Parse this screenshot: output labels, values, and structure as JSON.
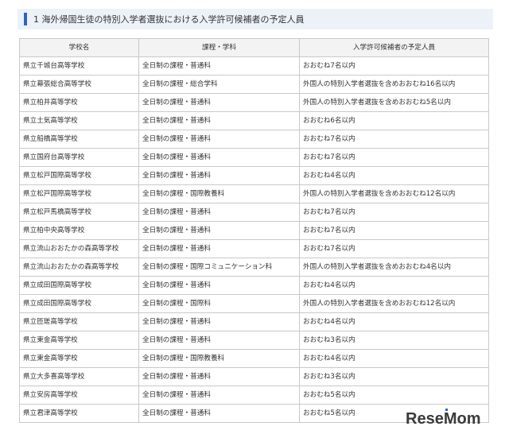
{
  "section": {
    "title": "1 海外帰国生徒の特別入学者選抜における入学許可候補者の予定人員"
  },
  "table": {
    "headers": [
      "学校名",
      "課程・学科",
      "入学許可候補者の予定人員"
    ],
    "rows": [
      [
        "県立千城台高等学校",
        "全日制の課程・普通科",
        "おおむね7名以内"
      ],
      [
        "県立幕張総合高等学校",
        "全日制の課程・総合学科",
        "外国人の特別入学者選抜を含めおおむね16名以内"
      ],
      [
        "県立柏井高等学校",
        "全日制の課程・普通科",
        "外国人の特別入学者選抜を含めおおむね5名以内"
      ],
      [
        "県立土気高等学校",
        "全日制の課程・普通科",
        "おおむね6名以内"
      ],
      [
        "県立船橋高等学校",
        "全日制の課程・普通科",
        "おおむね7名以内"
      ],
      [
        "県立国府台高等学校",
        "全日制の課程・普通科",
        "おおむね7名以内"
      ],
      [
        "県立松戸国際高等学校",
        "全日制の課程・普通科",
        "おおむね4名以内"
      ],
      [
        "県立松戸国際高等学校",
        "全日制の課程・国際教養科",
        "外国人の特別入学者選抜を含めおおむね12名以内"
      ],
      [
        "県立松戸馬橋高等学校",
        "全日制の課程・普通科",
        "おおむね7名以内"
      ],
      [
        "県立柏中央高等学校",
        "全日制の課程・普通科",
        "おおむね7名以内"
      ],
      [
        "県立流山おおたかの森高等学校",
        "全日制の課程・普通科",
        "おおむね7名以内"
      ],
      [
        "県立流山おおたかの森高等学校",
        "全日制の課程・国際コミュニケーション科",
        "外国人の特別入学者選抜を含めおおむね4名以内"
      ],
      [
        "県立成田国際高等学校",
        "全日制の課程・普通科",
        "おおむね4名以内"
      ],
      [
        "県立成田国際高等学校",
        "全日制の課程・国際科",
        "外国人の特別入学者選抜を含めおおむね12名以内"
      ],
      [
        "県立匝瑳高等学校",
        "全日制の課程・普通科",
        "おおむね4名以内"
      ],
      [
        "県立東金高等学校",
        "全日制の課程・普通科",
        "おおむね3名以内"
      ],
      [
        "県立東金高等学校",
        "全日制の課程・国際教養科",
        "おおむね4名以内"
      ],
      [
        "県立大多喜高等学校",
        "全日制の課程・普通科",
        "おおむね3名以内"
      ],
      [
        "県立安房高等学校",
        "全日制の課程・普通科",
        "おおむね5名以内"
      ],
      [
        "県立君津高等学校",
        "全日制の課程・普通科",
        "おおむね5名以内"
      ]
    ]
  },
  "watermark": {
    "logo_text": "ReseMom",
    "logo_color": "#3a3a3a",
    "accent_color": "#2f64bd"
  }
}
